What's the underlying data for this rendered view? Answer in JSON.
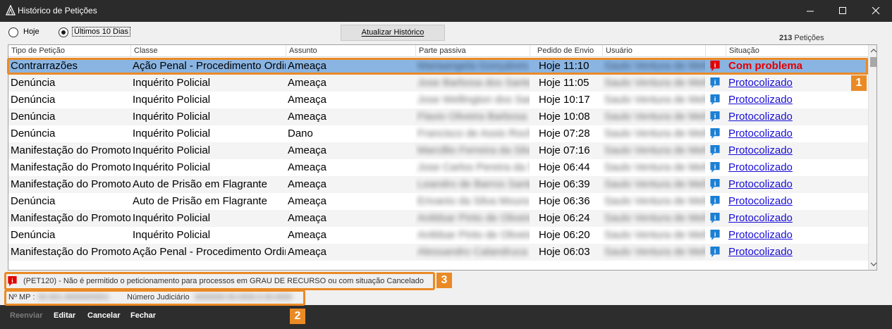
{
  "window": {
    "title": "Histórico de Petições"
  },
  "filters": {
    "today_label": "Hoje",
    "last10_label": "Últimos 10 Dias",
    "selected": "last10"
  },
  "toolbar": {
    "refresh_label": "Atualizar Histórico"
  },
  "summary": {
    "count": "213",
    "count_suffix": " Petições"
  },
  "table": {
    "columns": [
      "Tipo de Petição",
      "Classe",
      "Assunto",
      "Parte passiva",
      "Pedido de Envio",
      "Usuário",
      "",
      "Situação"
    ],
    "rows": [
      {
        "tipo": "Contrarrazões",
        "classe": "Ação Penal - Procedimento Ordinário",
        "assunto": "Ameaça",
        "parte": "Mariaangela Gonçalves",
        "pedido": "Hoje 11:10",
        "usuario": "Saulo Ventura de Mello",
        "situacao": "Com problema",
        "status": "problem",
        "selected": true
      },
      {
        "tipo": "Denúncia",
        "classe": "Inquérito Policial",
        "assunto": "Ameaça",
        "parte": "Jose Barbosa dos Santos",
        "pedido": "Hoje 11:05",
        "usuario": "Saulo Ventura de Mello",
        "situacao": "Protocolizado",
        "status": "ok"
      },
      {
        "tipo": "Denúncia",
        "classe": "Inquérito Policial",
        "assunto": "Ameaça",
        "parte": "Jose Wellington dos Santos",
        "pedido": "Hoje 10:17",
        "usuario": "Saulo Ventura de Mello",
        "situacao": "Protocolizado",
        "status": "ok"
      },
      {
        "tipo": "Denúncia",
        "classe": "Inquérito Policial",
        "assunto": "Ameaça",
        "parte": "Flavio Oliveira Barbosa",
        "pedido": "Hoje 10:08",
        "usuario": "Saulo Ventura de Mello",
        "situacao": "Protocolizado",
        "status": "ok"
      },
      {
        "tipo": "Denúncia",
        "classe": "Inquérito Policial",
        "assunto": "Dano",
        "parte": "Francisco de Assis Rocha",
        "pedido": "Hoje 07:28",
        "usuario": "Saulo Ventura de Mello",
        "situacao": "Protocolizado",
        "status": "ok"
      },
      {
        "tipo": "Manifestação do Promotor",
        "classe": "Inquérito Policial",
        "assunto": "Ameaça",
        "parte": "Marcillio Ferreira da Silva",
        "pedido": "Hoje 07:16",
        "usuario": "Saulo Ventura de Mello",
        "situacao": "Protocolizado",
        "status": "ok"
      },
      {
        "tipo": "Manifestação do Promotor",
        "classe": "Inquérito Policial",
        "assunto": "Ameaça",
        "parte": "Jose Carlos Pereira da Silva",
        "pedido": "Hoje 06:44",
        "usuario": "Saulo Ventura de Mello",
        "situacao": "Protocolizado",
        "status": "ok"
      },
      {
        "tipo": "Manifestação do Promotor",
        "classe": "Auto de Prisão em Flagrante",
        "assunto": "Ameaça",
        "parte": "Leandro de Barros Santos",
        "pedido": "Hoje 06:39",
        "usuario": "Saulo Ventura de Mello",
        "situacao": "Protocolizado",
        "status": "ok"
      },
      {
        "tipo": "Denúncia",
        "classe": "Auto de Prisão em Flagrante",
        "assunto": "Ameaça",
        "parte": "Erivanio da Silva Moura",
        "pedido": "Hoje 06:36",
        "usuario": "Saulo Ventura de Mello",
        "situacao": "Protocolizado",
        "status": "ok"
      },
      {
        "tipo": "Manifestação do Promotor",
        "classe": "Inquérito Policial",
        "assunto": "Ameaça",
        "parte": "Anildsar Pinto de Oliveira",
        "pedido": "Hoje 06:24",
        "usuario": "Saulo Ventura de Mello",
        "situacao": "Protocolizado",
        "status": "ok"
      },
      {
        "tipo": "Denúncia",
        "classe": "Inquérito Policial",
        "assunto": "Ameaça",
        "parte": "Anildsar Pinto de Oliveira",
        "pedido": "Hoje 06:20",
        "usuario": "Saulo Ventura de Mello",
        "situacao": "Protocolizado",
        "status": "ok"
      },
      {
        "tipo": "Manifestação do Promotor",
        "classe": "Ação Penal - Procedimento Ordinário",
        "assunto": "Ameaça",
        "parte": "Alessandro Calandruca",
        "pedido": "Hoje 06:03",
        "usuario": "Saulo Ventura de Mello",
        "situacao": "Protocolizado",
        "status": "ok"
      }
    ]
  },
  "message": {
    "text": "(PET120) - Não é permitido o peticionamento para processos em GRAU DE RECURSO ou com situação Cancelado"
  },
  "ids": {
    "mp_label": "Nº MP :",
    "mp_value": "00.001.000000/0001",
    "jud_label": "Número Judiciário",
    "jud_value": "0000000-00.0000.0.00.0000"
  },
  "actions": {
    "resend": "Reenviar",
    "edit": "Editar",
    "cancel": "Cancelar",
    "close": "Fechar"
  },
  "callouts": [
    "1",
    "2",
    "3"
  ],
  "colors": {
    "accent": "#ea8a25",
    "link": "#1a0dd6",
    "error": "#e00000",
    "selection": "#8ab4e2"
  }
}
